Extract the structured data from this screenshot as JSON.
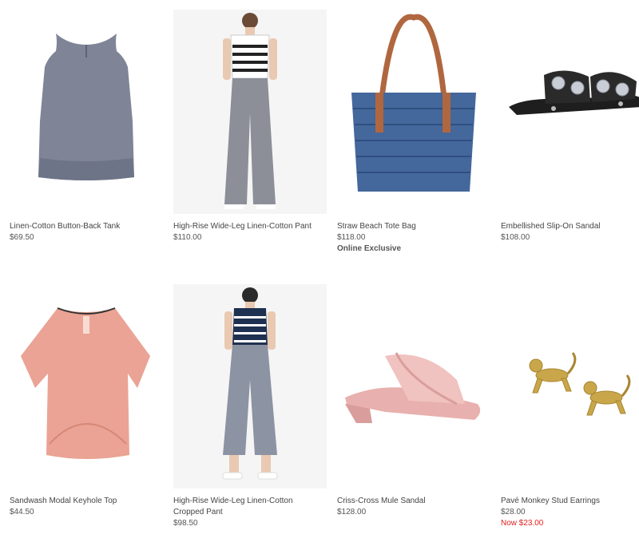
{
  "products": [
    {
      "name": "Linen-Cotton Button-Back Tank",
      "price": "$69.50",
      "image_icon": "tank-top-icon",
      "color": "#7f8597"
    },
    {
      "name": "High-Rise Wide-Leg Linen-Cotton Pant",
      "price": "$110.00",
      "image_icon": "wide-leg-pant-icon",
      "color": "#8c8f98"
    },
    {
      "name": "Straw Beach Tote Bag",
      "price": "$118.00",
      "badge": "Online Exclusive",
      "image_icon": "tote-bag-icon",
      "color": "#44679c"
    },
    {
      "name": "Embellished Slip-On Sandal",
      "price": "$108.00",
      "image_icon": "sandal-icon",
      "color": "#1e1e1e"
    },
    {
      "name": "Sandwash Modal Keyhole Top",
      "price": "$44.50",
      "image_icon": "blouse-icon",
      "color": "#eaa394"
    },
    {
      "name": "High-Rise Wide-Leg Linen-Cotton Cropped Pant",
      "price": "$98.50",
      "image_icon": "cropped-pant-icon",
      "color": "#8c93a3"
    },
    {
      "name": "Criss-Cross Mule Sandal",
      "price": "$128.00",
      "image_icon": "mule-sandal-icon",
      "color": "#e8b0ae"
    },
    {
      "name": "Pavé Monkey Stud Earrings",
      "price": "$28.00",
      "sale_price": "Now $23.00",
      "image_icon": "monkey-earring-icon",
      "color": "#c9a64a"
    }
  ],
  "colors": {
    "sale": "#e21e1e",
    "text": "#444444",
    "photo_bg": "#f5f5f5"
  }
}
